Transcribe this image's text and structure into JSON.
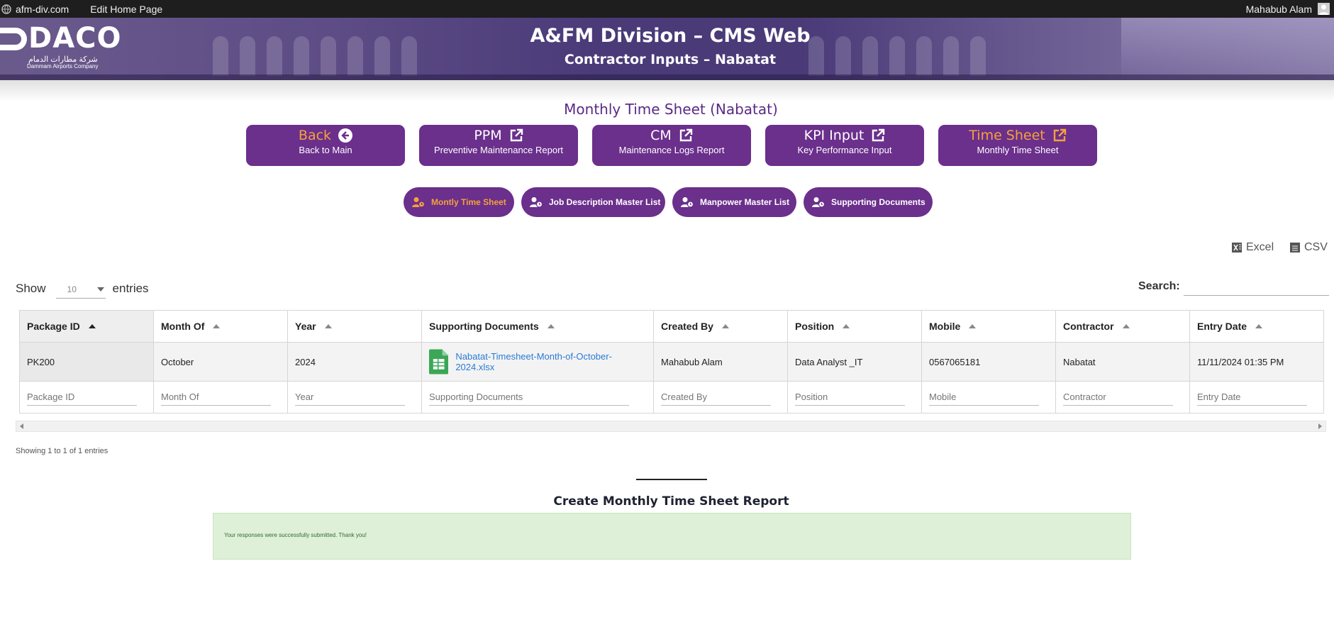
{
  "adminbar": {
    "site": "afm-div.com",
    "edit": "Edit Home Page",
    "user": "Mahabub Alam"
  },
  "banner": {
    "logo": "DACO",
    "logo_arabic": "شركة مطارات الدمام",
    "logo_sub": "Dammam Airports Company",
    "title": "A&FM Division – CMS Web",
    "subtitle": "Contractor Inputs – Nabatat"
  },
  "page_title": "Monthly Time Sheet (Nabatat)",
  "buttons": [
    {
      "title": "Back",
      "sub": "Back to Main",
      "icon": "arrow-left-circle-icon",
      "title_color": "#f4a23b"
    },
    {
      "title": "PPM",
      "sub": "Preventive Maintenance Report",
      "icon": "external-link-icon",
      "title_color": "#ffffff"
    },
    {
      "title": "CM",
      "sub": "Maintenance Logs Report",
      "icon": "external-link-icon",
      "title_color": "#ffffff"
    },
    {
      "title": "KPI Input",
      "sub": "Key Performance Input",
      "icon": "external-link-icon",
      "title_color": "#ffffff"
    },
    {
      "title": "Time Sheet",
      "sub": "Monthly Time Sheet",
      "icon": "external-link-icon",
      "title_color": "#f4a23b"
    }
  ],
  "tabs": [
    {
      "label": "Montly Time Sheet",
      "active": true
    },
    {
      "label": "Job Description Master List",
      "active": false
    },
    {
      "label": "Manpower Master List",
      "active": false
    },
    {
      "label": "Supporting Documents",
      "active": false
    }
  ],
  "export": {
    "excel": "Excel",
    "csv": "CSV"
  },
  "length": {
    "show": "Show",
    "value": "10",
    "entries": "entries"
  },
  "search": {
    "label": "Search:",
    "value": ""
  },
  "table": {
    "columns": [
      "Package ID",
      "Month Of",
      "Year",
      "Supporting Documents",
      "Created By",
      "Position",
      "Mobile",
      "Contractor",
      "Entry Date"
    ],
    "rows": [
      [
        "PK200",
        "October",
        "2024",
        "Nabatat-Timesheet-Month-of-October-2024.xlsx",
        "Mahabub Alam",
        "Data Analyst _IT",
        "0567065181",
        "Nabatat",
        "11/11/2024 01:35 PM"
      ]
    ],
    "filters": [
      "Package ID",
      "Month Of",
      "Year",
      "Supporting Documents",
      "Created By",
      "Position",
      "Mobile",
      "Contractor",
      "Entry Date"
    ]
  },
  "info": "Showing 1 to 1 of 1 entries",
  "form": {
    "title": "Create Monthly Time Sheet Report",
    "success": "Your responses were successfully submitted. Thank you!"
  },
  "colors": {
    "purple": "#6b2f8c",
    "orange": "#f4a23b",
    "title_purple": "#5b2a86",
    "success_bg": "#dff0d8",
    "link": "#2a7bd6"
  }
}
